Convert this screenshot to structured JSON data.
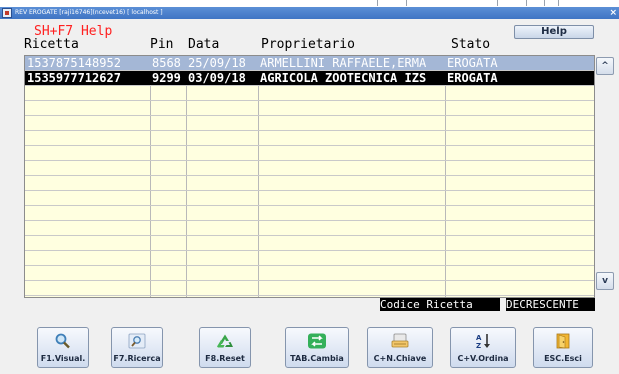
{
  "window": {
    "title": "REV EROGATE [raji16746](ncevet16) [ localhost ]",
    "close_glyph": "×"
  },
  "toolbar": {
    "help_hint": "SH+F7 Help",
    "help_button": "Help"
  },
  "table": {
    "columns": [
      "Ricetta",
      "Pin",
      "Data",
      "Proprietario",
      "Stato"
    ],
    "rows": [
      {
        "ricetta": "1537875148952",
        "pin": "8568",
        "data": "25/09/18",
        "proprietario": "ARMELLINI RAFFAELE,ERMA",
        "stato": "EROGATA"
      },
      {
        "ricetta": "1535977712627",
        "pin": "9299",
        "data": "03/09/18",
        "proprietario": "AGRICOLA ZOOTECNICA IZS",
        "stato": "EROGATA"
      }
    ],
    "scroll_up": "^",
    "scroll_down": "v"
  },
  "sort": {
    "field": "Codice Ricetta",
    "direction": "DECRESCENTE"
  },
  "buttons": [
    {
      "label": "F1.Visual.",
      "icon": "magnifier-icon"
    },
    {
      "label": "F7.Ricerca",
      "icon": "search-icon"
    },
    {
      "label": "F8.Reset",
      "icon": "recycle-icon"
    },
    {
      "label": "TAB.Cambia",
      "icon": "switch-icon"
    },
    {
      "label": "C+N.Chiave",
      "icon": "keyboard-icon"
    },
    {
      "label": "C+V.Ordina",
      "icon": "sort-az-icon"
    },
    {
      "label": "ESC.Esci",
      "icon": "exit-door-icon"
    }
  ],
  "colors": {
    "grid_background": "#ffffe0",
    "selected_row": "#a4b7d6",
    "active_row": "#000000",
    "help_hint": "#ff2020"
  }
}
